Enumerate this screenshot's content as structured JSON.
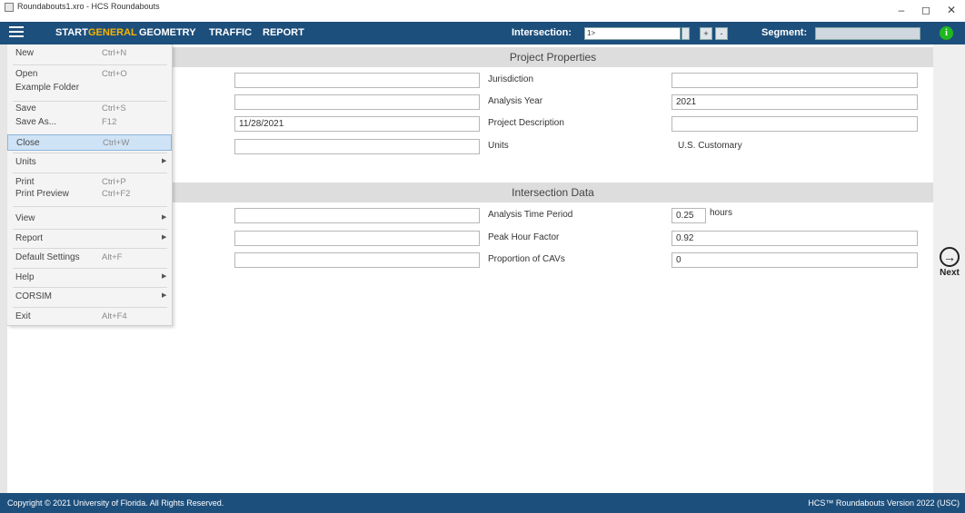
{
  "window": {
    "title": "Roundabouts1.xro - HCS Roundabouts",
    "minimize": "–",
    "restore": "◻",
    "close": "✕"
  },
  "nav": {
    "tabs": [
      {
        "label": "START",
        "active": false
      },
      {
        "label": "GENERAL",
        "active": true
      },
      {
        "label": "GEOMETRY",
        "active": false
      },
      {
        "label": "TRAFFIC",
        "active": false
      },
      {
        "label": "REPORT",
        "active": false
      }
    ],
    "intersection_label": "Intersection:",
    "intersection_value": "1>",
    "add_btn": "+",
    "remove_btn": "-",
    "segment_label": "Segment:",
    "info_icon": "i"
  },
  "menu": {
    "items": [
      {
        "label": "New",
        "shortcut": "Ctrl+N"
      },
      {
        "label": "Open",
        "shortcut": "Ctrl+O"
      },
      {
        "label": "Example Folder",
        "shortcut": ""
      },
      {
        "label": "Save",
        "shortcut": "Ctrl+S"
      },
      {
        "label": "Save As...",
        "shortcut": "F12"
      },
      {
        "label": "Close",
        "shortcut": "Ctrl+W"
      },
      {
        "label": "Units",
        "shortcut": ""
      },
      {
        "label": "Print",
        "shortcut": "Ctrl+P"
      },
      {
        "label": "Print Preview",
        "shortcut": "Ctrl+F2"
      },
      {
        "label": "View",
        "shortcut": ""
      },
      {
        "label": "Report",
        "shortcut": ""
      },
      {
        "label": "Default Settings",
        "shortcut": "Alt+F"
      },
      {
        "label": "Help",
        "shortcut": ""
      },
      {
        "label": "CORSIM",
        "shortcut": ""
      },
      {
        "label": "Exit",
        "shortcut": "Alt+F4"
      }
    ],
    "submenu_arrow": "▶"
  },
  "project": {
    "header": "Project Properties",
    "date_value": "11/28/2021",
    "jurisdiction_label": "Jurisdiction",
    "analysis_year_label": "Analysis Year",
    "analysis_year_value": "2021",
    "project_description_label": "Project Description",
    "units_label": "Units",
    "units_value": "U.S. Customary"
  },
  "intersection": {
    "header": "Intersection Data",
    "analysis_time_period_label": "Analysis Time Period",
    "analysis_time_period_value": "0.25",
    "analysis_time_period_unit": "hours",
    "peak_hour_factor_label": "Peak Hour Factor",
    "peak_hour_factor_value": "0.92",
    "proportion_cavs_label": "Proportion of CAVs",
    "proportion_cavs_value": "0"
  },
  "next": {
    "label": "Next",
    "icon": "→"
  },
  "footer": {
    "copyright": "Copyright © 2021 University of Florida. All Rights Reserved.",
    "version": "HCS™ Roundabouts Version 2022 (USC)"
  },
  "colors": {
    "nav_bg": "#1d4f7c",
    "active_tab": "#f5b400",
    "info_green": "#1fb81f"
  }
}
